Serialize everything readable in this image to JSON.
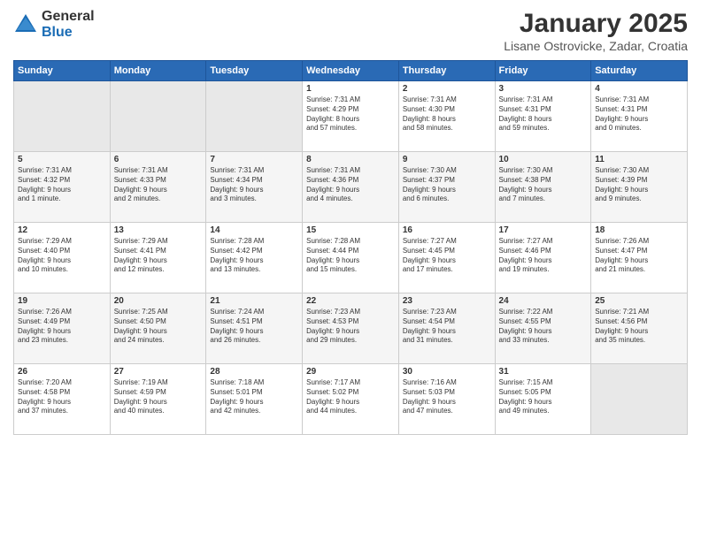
{
  "logo": {
    "general": "General",
    "blue": "Blue"
  },
  "header": {
    "title": "January 2025",
    "subtitle": "Lisane Ostrovicke, Zadar, Croatia"
  },
  "weekdays": [
    "Sunday",
    "Monday",
    "Tuesday",
    "Wednesday",
    "Thursday",
    "Friday",
    "Saturday"
  ],
  "weeks": [
    [
      {
        "day": "",
        "info": ""
      },
      {
        "day": "",
        "info": ""
      },
      {
        "day": "",
        "info": ""
      },
      {
        "day": "1",
        "info": "Sunrise: 7:31 AM\nSunset: 4:29 PM\nDaylight: 8 hours\nand 57 minutes."
      },
      {
        "day": "2",
        "info": "Sunrise: 7:31 AM\nSunset: 4:30 PM\nDaylight: 8 hours\nand 58 minutes."
      },
      {
        "day": "3",
        "info": "Sunrise: 7:31 AM\nSunset: 4:31 PM\nDaylight: 8 hours\nand 59 minutes."
      },
      {
        "day": "4",
        "info": "Sunrise: 7:31 AM\nSunset: 4:31 PM\nDaylight: 9 hours\nand 0 minutes."
      }
    ],
    [
      {
        "day": "5",
        "info": "Sunrise: 7:31 AM\nSunset: 4:32 PM\nDaylight: 9 hours\nand 1 minute."
      },
      {
        "day": "6",
        "info": "Sunrise: 7:31 AM\nSunset: 4:33 PM\nDaylight: 9 hours\nand 2 minutes."
      },
      {
        "day": "7",
        "info": "Sunrise: 7:31 AM\nSunset: 4:34 PM\nDaylight: 9 hours\nand 3 minutes."
      },
      {
        "day": "8",
        "info": "Sunrise: 7:31 AM\nSunset: 4:36 PM\nDaylight: 9 hours\nand 4 minutes."
      },
      {
        "day": "9",
        "info": "Sunrise: 7:30 AM\nSunset: 4:37 PM\nDaylight: 9 hours\nand 6 minutes."
      },
      {
        "day": "10",
        "info": "Sunrise: 7:30 AM\nSunset: 4:38 PM\nDaylight: 9 hours\nand 7 minutes."
      },
      {
        "day": "11",
        "info": "Sunrise: 7:30 AM\nSunset: 4:39 PM\nDaylight: 9 hours\nand 9 minutes."
      }
    ],
    [
      {
        "day": "12",
        "info": "Sunrise: 7:29 AM\nSunset: 4:40 PM\nDaylight: 9 hours\nand 10 minutes."
      },
      {
        "day": "13",
        "info": "Sunrise: 7:29 AM\nSunset: 4:41 PM\nDaylight: 9 hours\nand 12 minutes."
      },
      {
        "day": "14",
        "info": "Sunrise: 7:28 AM\nSunset: 4:42 PM\nDaylight: 9 hours\nand 13 minutes."
      },
      {
        "day": "15",
        "info": "Sunrise: 7:28 AM\nSunset: 4:44 PM\nDaylight: 9 hours\nand 15 minutes."
      },
      {
        "day": "16",
        "info": "Sunrise: 7:27 AM\nSunset: 4:45 PM\nDaylight: 9 hours\nand 17 minutes."
      },
      {
        "day": "17",
        "info": "Sunrise: 7:27 AM\nSunset: 4:46 PM\nDaylight: 9 hours\nand 19 minutes."
      },
      {
        "day": "18",
        "info": "Sunrise: 7:26 AM\nSunset: 4:47 PM\nDaylight: 9 hours\nand 21 minutes."
      }
    ],
    [
      {
        "day": "19",
        "info": "Sunrise: 7:26 AM\nSunset: 4:49 PM\nDaylight: 9 hours\nand 23 minutes."
      },
      {
        "day": "20",
        "info": "Sunrise: 7:25 AM\nSunset: 4:50 PM\nDaylight: 9 hours\nand 24 minutes."
      },
      {
        "day": "21",
        "info": "Sunrise: 7:24 AM\nSunset: 4:51 PM\nDaylight: 9 hours\nand 26 minutes."
      },
      {
        "day": "22",
        "info": "Sunrise: 7:23 AM\nSunset: 4:53 PM\nDaylight: 9 hours\nand 29 minutes."
      },
      {
        "day": "23",
        "info": "Sunrise: 7:23 AM\nSunset: 4:54 PM\nDaylight: 9 hours\nand 31 minutes."
      },
      {
        "day": "24",
        "info": "Sunrise: 7:22 AM\nSunset: 4:55 PM\nDaylight: 9 hours\nand 33 minutes."
      },
      {
        "day": "25",
        "info": "Sunrise: 7:21 AM\nSunset: 4:56 PM\nDaylight: 9 hours\nand 35 minutes."
      }
    ],
    [
      {
        "day": "26",
        "info": "Sunrise: 7:20 AM\nSunset: 4:58 PM\nDaylight: 9 hours\nand 37 minutes."
      },
      {
        "day": "27",
        "info": "Sunrise: 7:19 AM\nSunset: 4:59 PM\nDaylight: 9 hours\nand 40 minutes."
      },
      {
        "day": "28",
        "info": "Sunrise: 7:18 AM\nSunset: 5:01 PM\nDaylight: 9 hours\nand 42 minutes."
      },
      {
        "day": "29",
        "info": "Sunrise: 7:17 AM\nSunset: 5:02 PM\nDaylight: 9 hours\nand 44 minutes."
      },
      {
        "day": "30",
        "info": "Sunrise: 7:16 AM\nSunset: 5:03 PM\nDaylight: 9 hours\nand 47 minutes."
      },
      {
        "day": "31",
        "info": "Sunrise: 7:15 AM\nSunset: 5:05 PM\nDaylight: 9 hours\nand 49 minutes."
      },
      {
        "day": "",
        "info": ""
      }
    ]
  ]
}
